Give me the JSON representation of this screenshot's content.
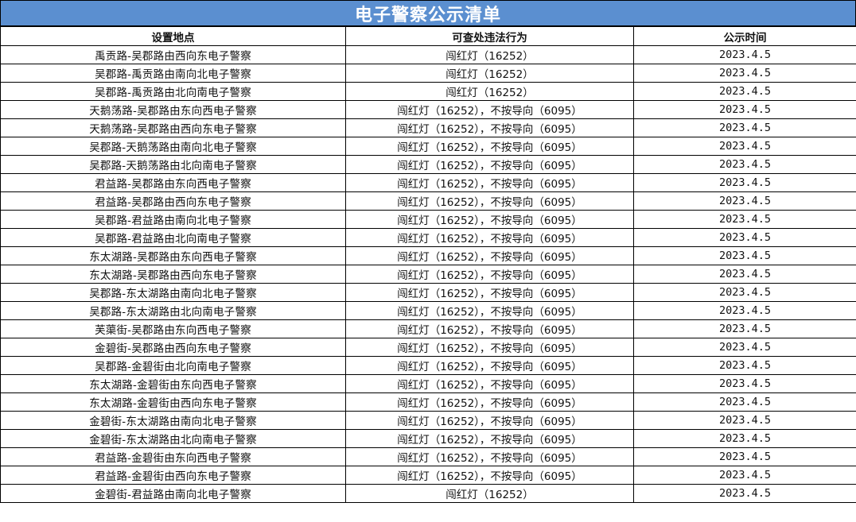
{
  "title": "电子警察公示清单",
  "columns": {
    "location": "设置地点",
    "violation": "可查处违法行为",
    "date": "公示时间"
  },
  "rows": [
    {
      "location": "禹贡路-吴郡路由西向东电子警察",
      "violation": "闯红灯（16252）",
      "date": "2023.4.5"
    },
    {
      "location": "吴郡路-禹贡路由南向北电子警察",
      "violation": "闯红灯（16252）",
      "date": "2023.4.5"
    },
    {
      "location": "吴郡路-禹贡路由北向南电子警察",
      "violation": "闯红灯（16252）",
      "date": "2023.4.5"
    },
    {
      "location": "天鹅荡路-吴郡路由东向西电子警察",
      "violation": "闯红灯（16252），不按导向（6095）",
      "date": "2023.4.5"
    },
    {
      "location": "天鹅荡路-吴郡路由西向东电子警察",
      "violation": "闯红灯（16252），不按导向（6095）",
      "date": "2023.4.5"
    },
    {
      "location": "吴郡路-天鹅荡路由南向北电子警察",
      "violation": "闯红灯（16252），不按导向（6095）",
      "date": "2023.4.5"
    },
    {
      "location": "吴郡路-天鹅荡路由北向南电子警察",
      "violation": "闯红灯（16252），不按导向（6095）",
      "date": "2023.4.5"
    },
    {
      "location": "君益路-吴郡路由东向西电子警察",
      "violation": "闯红灯（16252），不按导向（6095）",
      "date": "2023.4.5"
    },
    {
      "location": "君益路-吴郡路由西向东电子警察",
      "violation": "闯红灯（16252），不按导向（6095）",
      "date": "2023.4.5"
    },
    {
      "location": "吴郡路-君益路由南向北电子警察",
      "violation": "闯红灯（16252），不按导向（6095）",
      "date": "2023.4.5"
    },
    {
      "location": "吴郡路-君益路由北向南电子警察",
      "violation": "闯红灯（16252），不按导向（6095）",
      "date": "2023.4.5"
    },
    {
      "location": "东太湖路-吴郡路由东向西电子警察",
      "violation": "闯红灯（16252），不按导向（6095）",
      "date": "2023.4.5"
    },
    {
      "location": "东太湖路-吴郡路由西向东电子警察",
      "violation": "闯红灯（16252），不按导向（6095）",
      "date": "2023.4.5"
    },
    {
      "location": "吴郡路-东太湖路由南向北电子警察",
      "violation": "闯红灯（16252），不按导向（6095）",
      "date": "2023.4.5"
    },
    {
      "location": "吴郡路-东太湖路由北向南电子警察",
      "violation": "闯红灯（16252），不按导向（6095）",
      "date": "2023.4.5"
    },
    {
      "location": "芙蕖街-吴郡路由东向西电子警察",
      "violation": "闯红灯（16252），不按导向（6095）",
      "date": "2023.4.5"
    },
    {
      "location": "金碧街-吴郡路由西向东电子警察",
      "violation": "闯红灯（16252），不按导向（6095）",
      "date": "2023.4.5"
    },
    {
      "location": "吴郡路-金碧街由北向南电子警察",
      "violation": "闯红灯（16252），不按导向（6095）",
      "date": "2023.4.5"
    },
    {
      "location": "东太湖路-金碧街由东向西电子警察",
      "violation": "闯红灯（16252），不按导向（6095）",
      "date": "2023.4.5"
    },
    {
      "location": "东太湖路-金碧街由西向东电子警察",
      "violation": "闯红灯（16252），不按导向（6095）",
      "date": "2023.4.5"
    },
    {
      "location": "金碧街-东太湖路由南向北电子警察",
      "violation": "闯红灯（16252），不按导向（6095）",
      "date": "2023.4.5"
    },
    {
      "location": "金碧街-东太湖路由北向南电子警察",
      "violation": "闯红灯（16252），不按导向（6095）",
      "date": "2023.4.5"
    },
    {
      "location": "君益路-金碧街由东向西电子警察",
      "violation": "闯红灯（16252），不按导向（6095）",
      "date": "2023.4.5"
    },
    {
      "location": "君益路-金碧街由西向东电子警察",
      "violation": "闯红灯（16252），不按导向（6095）",
      "date": "2023.4.5"
    },
    {
      "location": "金碧街-君益路由南向北电子警察",
      "violation": "闯红灯（16252）",
      "date": "2023.4.5"
    }
  ],
  "colors": {
    "title_bar": "#5b8fd0",
    "title_text": "#ffffff",
    "grid": "#000000"
  }
}
